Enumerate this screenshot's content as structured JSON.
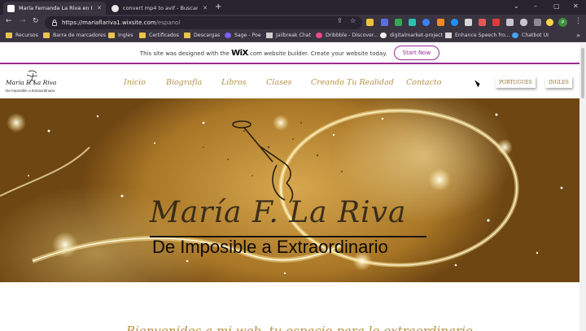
{
  "browser": {
    "tabs": [
      {
        "title": "María Fernanda La Riva en Españ",
        "active": true
      },
      {
        "title": "convert mp4 to avif - Buscar con",
        "active": false
      }
    ],
    "new_tab": "+",
    "window_controls": [
      "⌄",
      "–",
      "▢",
      "✕"
    ],
    "url_host": "https://mariaflariva1.wixsite.com",
    "url_path": "/espanol",
    "profile_initial": "P",
    "bookmarks": [
      {
        "label": "Recursos",
        "icon": "folder-icon"
      },
      {
        "label": "Barra de marcadores",
        "icon": "folder-icon"
      },
      {
        "label": "Ingles",
        "icon": "folder-icon"
      },
      {
        "label": "Certificados",
        "icon": "folder-icon"
      },
      {
        "label": "Descargas",
        "icon": "folder-icon"
      },
      {
        "label": "Sage - Poe",
        "icon": "poe-icon"
      },
      {
        "label": "Jailbreak Chat",
        "icon": "jailbreak-icon"
      },
      {
        "label": "Dribbble - Discover...",
        "icon": "dribbble-icon"
      },
      {
        "label": "digitalmarket-project",
        "icon": "github-icon"
      },
      {
        "label": "Enhance Speech fro...",
        "icon": "enhance-icon"
      },
      {
        "label": "Chatbot UI",
        "icon": "chatbot-icon"
      }
    ]
  },
  "wix_banner": {
    "text_before": "This site was designed with the ",
    "brand": "WiX",
    "text_after": ".com website builder. Create your website today.",
    "cta": "Start Now"
  },
  "site": {
    "logo_name": "María F. La Riva",
    "logo_tagline": "De Imposible a Extraordinario",
    "nav": [
      "Inicio",
      "Biografía",
      "Libros",
      "Clases",
      "Creando Tu Realidad",
      "Contacto"
    ],
    "languages": [
      "PORTUGUES",
      "INGLES"
    ],
    "hero_title": "María F. La Riva",
    "hero_subtitle": "De Imposible a Extraordinario",
    "section_heading": "Bienvenidos a mi web, tu espacio para lo extraordinario"
  },
  "colors": {
    "accent_purple": "#9a2c91",
    "gold": "#b59045",
    "browser_dark": "#28232e"
  }
}
